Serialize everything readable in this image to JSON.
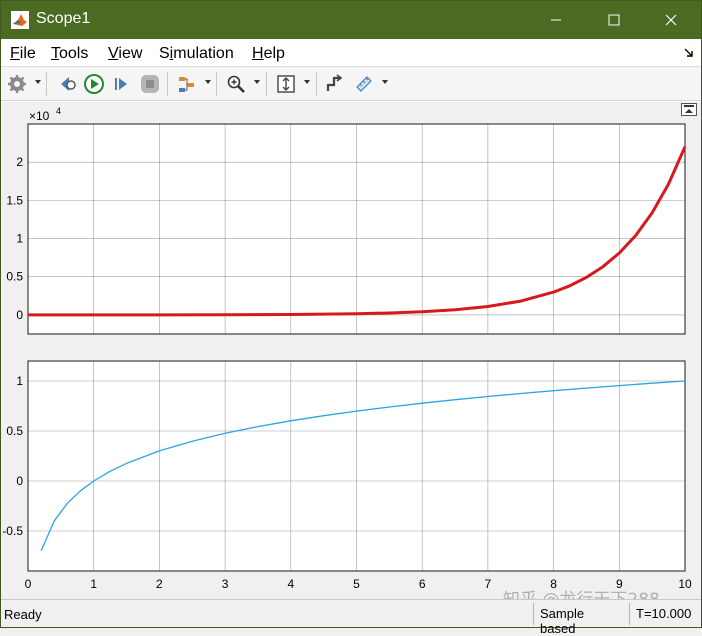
{
  "window": {
    "title": "Scope1"
  },
  "menu": {
    "items": [
      {
        "label": "File",
        "mnemonic": "F",
        "rest": "ile"
      },
      {
        "label": "Tools",
        "mnemonic": "T",
        "rest": "ools"
      },
      {
        "label": "View",
        "mnemonic": "V",
        "rest": "iew"
      },
      {
        "label": "Simulation",
        "mnemonic": "i",
        "pre": "S",
        "rest": "mulation"
      },
      {
        "label": "Help",
        "mnemonic": "H",
        "rest": "elp"
      }
    ]
  },
  "toolbar": {
    "icons": [
      "gear-icon",
      "step-back-icon",
      "run-icon",
      "step-forward-icon",
      "stop-icon",
      "signal-select-icon",
      "zoom-in-icon",
      "autoscale-icon",
      "cursor-measure-icon",
      "triggers-icon"
    ]
  },
  "status": {
    "ready": "Ready",
    "mode": "Sample based",
    "time": "T=10.000"
  },
  "watermark": "知乎 @龙行天下288",
  "colors": {
    "title_bar": "#4a6b21",
    "series_top": "#d7191c",
    "series_bottom": "#2aa6dc"
  },
  "chart_data": [
    {
      "type": "line",
      "xlim": [
        0,
        10
      ],
      "ylim": [
        -0.25,
        2.5
      ],
      "y_exponent_label": "×10",
      "y_exponent": "4",
      "yticks": [
        0,
        0.5,
        1,
        1.5,
        2
      ],
      "ytick_labels": [
        "0",
        "0.5",
        "1",
        "1.5",
        "2"
      ],
      "grid": true,
      "series": [
        {
          "color": "#d7191c",
          "x": [
            0,
            1,
            2,
            3,
            4,
            5,
            5.5,
            6,
            6.5,
            7,
            7.5,
            8,
            8.25,
            8.5,
            8.75,
            9,
            9.25,
            9.5,
            9.75,
            10
          ],
          "y": [
            0.0001,
            0.0003,
            0.0007,
            0.002,
            0.0055,
            0.0148,
            0.0245,
            0.0403,
            0.0665,
            0.1097,
            0.1808,
            0.2981,
            0.3827,
            0.4914,
            0.631,
            0.8103,
            1.0405,
            1.336,
            1.7154,
            2.2026
          ]
        }
      ]
    },
    {
      "type": "line",
      "xlim": [
        0,
        10
      ],
      "ylim": [
        -0.9,
        1.2
      ],
      "yticks": [
        -0.5,
        0,
        0.5,
        1
      ],
      "ytick_labels": [
        "-0.5",
        "0",
        "0.5",
        "1"
      ],
      "xticks": [
        0,
        1,
        2,
        3,
        4,
        5,
        6,
        7,
        8,
        9,
        10
      ],
      "xtick_labels": [
        "0",
        "1",
        "2",
        "3",
        "4",
        "5",
        "6",
        "7",
        "8",
        "9",
        "10"
      ],
      "grid": true,
      "series": [
        {
          "color": "#2aa6dc",
          "x": [
            0.2,
            0.4,
            0.6,
            0.8,
            1,
            1.25,
            1.5,
            2,
            2.5,
            3,
            3.5,
            4,
            4.5,
            5,
            5.5,
            6,
            6.5,
            7,
            7.5,
            8,
            8.5,
            9,
            9.5,
            10
          ],
          "y": [
            -0.699,
            -0.398,
            -0.222,
            -0.097,
            0,
            0.097,
            0.176,
            0.301,
            0.398,
            0.477,
            0.544,
            0.602,
            0.653,
            0.699,
            0.74,
            0.778,
            0.813,
            0.845,
            0.875,
            0.903,
            0.929,
            0.954,
            0.978,
            1
          ]
        }
      ]
    }
  ]
}
